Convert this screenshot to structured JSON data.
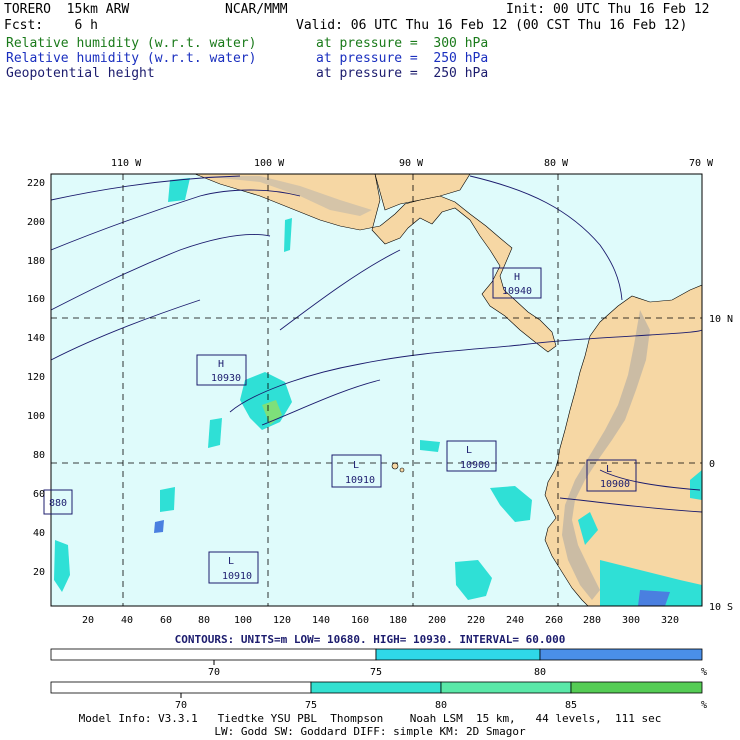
{
  "header": {
    "model": "TORERO  15km ARW",
    "org": "NCAR/MMM",
    "init": "Init: 00 UTC Thu 16 Feb 12",
    "fcst": "Fcst:    6 h",
    "valid": "Valid: 06 UTC Thu 16 Feb 12 (00 CST Thu 16 Feb 12)",
    "fields": [
      {
        "name": "Relative humidity (w.r.t. water)",
        "level": "at pressure =  300 hPa",
        "color": "#1a7a1a"
      },
      {
        "name": "Relative humidity (w.r.t. water)",
        "level": "at pressure =  250 hPa",
        "color": "#1a2fbf"
      },
      {
        "name": "Geopotential height",
        "level": "at pressure =  250 hPa",
        "color": "#1c1c6e"
      }
    ]
  },
  "map": {
    "lon_labels": [
      "110 W",
      "100 W",
      "90 W",
      "80 W",
      "70 W"
    ],
    "lat_labels": [
      "10 N",
      "0",
      "10 S"
    ],
    "y_axis": [
      "220",
      "200",
      "180",
      "160",
      "140",
      "120",
      "100",
      "80",
      "60",
      "40",
      "20"
    ],
    "x_axis": [
      "20",
      "40",
      "60",
      "80",
      "100",
      "120",
      "140",
      "160",
      "180",
      "200",
      "220",
      "240",
      "260",
      "280",
      "300",
      "320"
    ],
    "colors": {
      "ocean": "#dffbfb",
      "land": "#f6d7a4",
      "rh_cyan": "#2fe0d6",
      "rh_green": "#7ee07a",
      "rh_blue": "#4a7fe0"
    },
    "centers": [
      {
        "type": "H",
        "value": "10940"
      },
      {
        "type": "H",
        "value": "10930"
      },
      {
        "type": "L",
        "value": "10910"
      },
      {
        "type": "L",
        "value": "10900"
      },
      {
        "type": "L",
        "value": "10900"
      },
      {
        "type": "L",
        "value": "10910"
      },
      {
        "type": "",
        "value": "880"
      }
    ]
  },
  "contours": "CONTOURS:  UNITS=m  LOW=  10680.     HIGH=  10930.     INTERVAL=   60.000",
  "colorbar_250": {
    "ticks": [
      "70",
      "75",
      "80"
    ],
    "unit": "%",
    "colors": [
      "#ffffff",
      "#2fd8e8",
      "#4a8fe8"
    ]
  },
  "colorbar_300": {
    "ticks": [
      "70",
      "75",
      "80",
      "85"
    ],
    "unit": "%",
    "colors": [
      "#ffffff",
      "#33e0d0",
      "#5ae8a8",
      "#55cc55"
    ]
  },
  "footer": {
    "line1": "Model Info: V3.3.1   Tiedtke YSU PBL  Thompson    Noah LSM  15 km,   44 levels,  111 sec",
    "line2": "LW: Godd SW: Goddard DIFF: simple KM: 2D Smagor"
  }
}
